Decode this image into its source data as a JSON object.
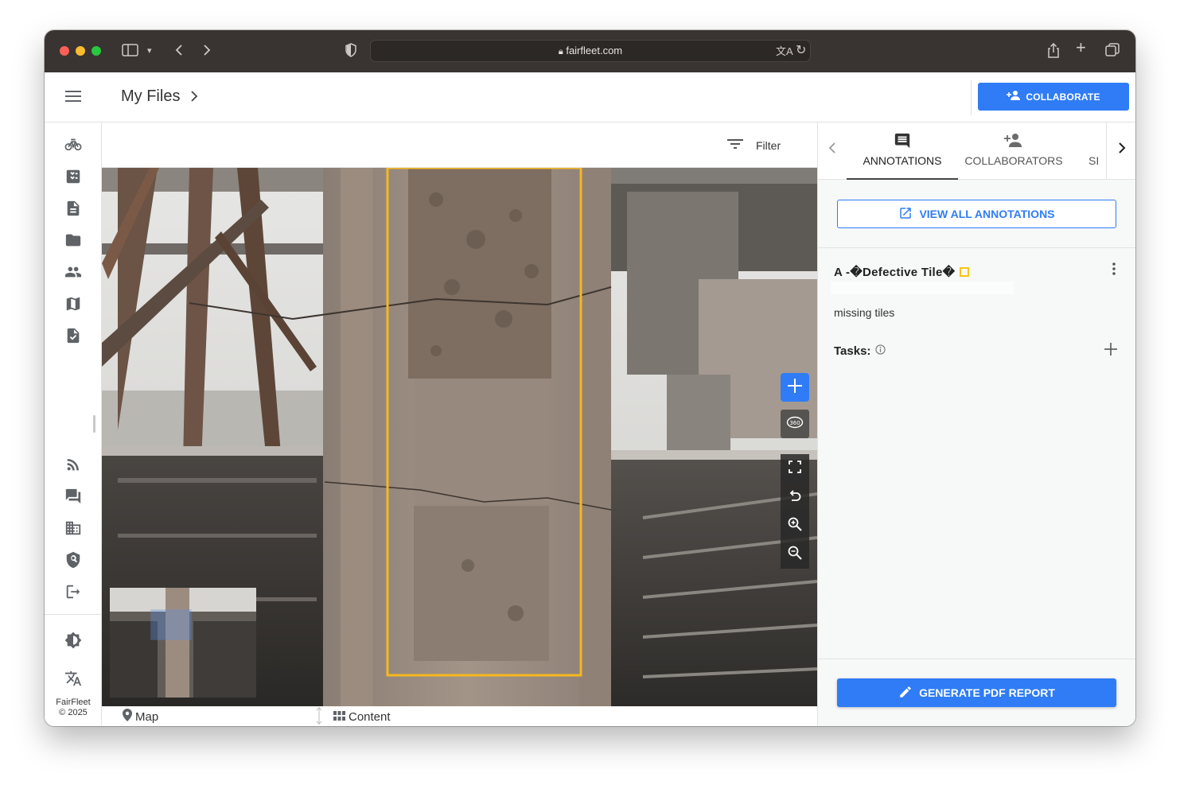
{
  "browser": {
    "url": "fairfleet.com"
  },
  "header": {
    "title": "My Files",
    "collaborate_label": "COLLABORATE"
  },
  "sidebar": {
    "brand_name": "FairFleet",
    "brand_year": "© 2025",
    "items": [
      {
        "icon": "drone-icon"
      },
      {
        "icon": "task-list-icon"
      },
      {
        "icon": "document-icon"
      },
      {
        "icon": "folder-icon"
      },
      {
        "icon": "people-icon"
      },
      {
        "icon": "map-icon"
      },
      {
        "icon": "checked-document-icon"
      },
      {
        "icon": "rss-feed-icon"
      },
      {
        "icon": "forum-icon"
      },
      {
        "icon": "building-icon"
      },
      {
        "icon": "security-search-icon"
      },
      {
        "icon": "logout-icon"
      },
      {
        "icon": "brightness-icon"
      },
      {
        "icon": "translate-icon"
      }
    ]
  },
  "viewer": {
    "filter_label": "Filter",
    "map_label": "Map",
    "content_label": "Content",
    "accent_color": "#f5b820"
  },
  "panel": {
    "tabs": [
      {
        "label": "ANNOTATIONS",
        "active": true
      },
      {
        "label": "COLLABORATORS",
        "active": false
      },
      {
        "label": "SI",
        "active": false
      }
    ],
    "view_all_label": "VIEW ALL ANNOTATIONS",
    "annotation": {
      "title": "A -�Defective Tile�",
      "description": "missing tiles",
      "tasks_label": "Tasks:"
    },
    "generate_label": "GENERATE PDF REPORT"
  },
  "colors": {
    "primary": "#2f7cf6",
    "annotation": "#f5c518"
  }
}
